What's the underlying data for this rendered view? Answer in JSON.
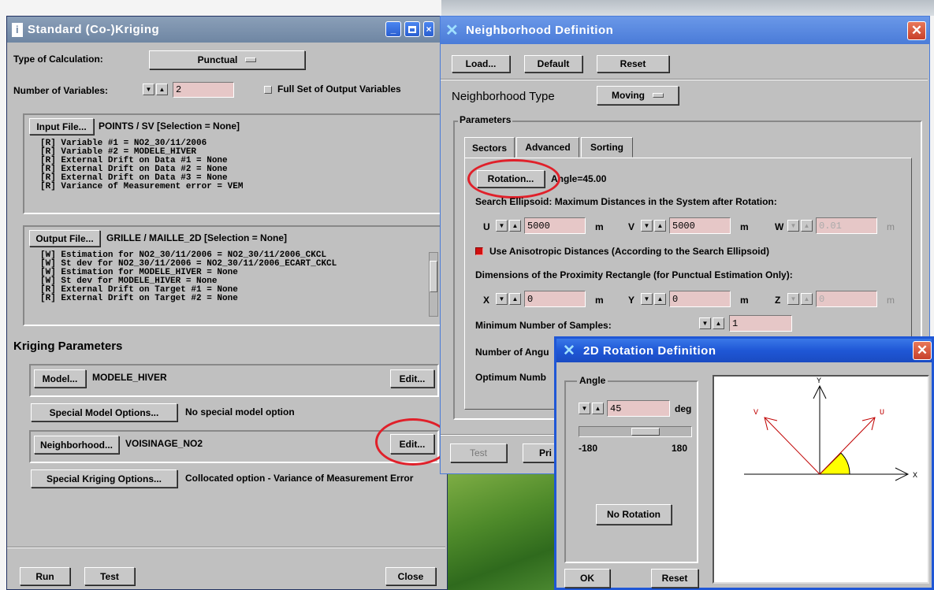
{
  "kriging": {
    "title": "Standard (Co-)Kriging",
    "calc_label": "Type of Calculation:",
    "calc_value": "Punctual",
    "numvars_label": "Number of Variables:",
    "numvars_value": "2",
    "fullset_label": "Full Set of Output Variables",
    "input_button": "Input File...",
    "input_file": "POINTS / SV [Selection = None]",
    "input_lines": [
      "[R] Variable #1 = NO2_30/11/2006",
      "[R] Variable #2 = MODELE_HIVER",
      "[R] External Drift on Data #1 = None",
      "[R] External Drift on Data #2 = None",
      "[R] External Drift on Data #3 = None",
      "[R] Variance of Measurement error = VEM"
    ],
    "output_button": "Output File...",
    "output_file": "GRILLE / MAILLE_2D [Selection = None]",
    "output_lines": [
      "[W] Estimation for NO2_30/11/2006 = NO2_30/11/2006_CKCL",
      "[W] St dev for NO2_30/11/2006 = NO2_30/11/2006_ECART_CKCL",
      "[W] Estimation for MODELE_HIVER = None",
      "[W] St dev for MODELE_HIVER = None",
      "[R] External Drift on Target #1 = None",
      "[R] External Drift on Target #2 = None"
    ],
    "params_heading": "Kriging Parameters",
    "model_button": "Model...",
    "model_value": "MODELE_HIVER",
    "edit_label": "Edit...",
    "special_model_button": "Special Model Options...",
    "special_model_value": "No special model option",
    "neigh_button": "Neighborhood...",
    "neigh_value": "VOISINAGE_NO2",
    "special_kriging_button": "Special Kriging Options...",
    "special_kriging_value": "Collocated option - Variance of Measurement Error",
    "run": "Run",
    "test": "Test",
    "close": "Close"
  },
  "neighborhood": {
    "title": "Neighborhood Definition",
    "load": "Load...",
    "default": "Default",
    "reset": "Reset",
    "type_label": "Neighborhood Type",
    "type_value": "Moving",
    "params_label": "Parameters",
    "tabs": [
      "Sectors",
      "Advanced",
      "Sorting"
    ],
    "rotation_button": "Rotation...",
    "angle_text": "Angle=45.00",
    "search_label": "Search Ellipsoid: Maximum Distances in the System after Rotation:",
    "u_label": "U",
    "u_value": "5000",
    "v_label": "V",
    "v_value": "5000",
    "w_label": "W",
    "w_value": "0.01",
    "unit_m": "m",
    "aniso_label": "Use Anisotropic Distances (According to the Search Ellipsoid)",
    "rect_label": "Dimensions of the Proximity Rectangle (for Punctual Estimation Only):",
    "x_label": "X",
    "x_value": "0",
    "y_label": "Y",
    "y_value": "0",
    "z_label": "Z",
    "z_value": "0",
    "min_samples_label": "Minimum Number of Samples:",
    "min_samples_value": "1",
    "num_angular_label": "Number of Angu",
    "optimum_label": "Optimum Numb",
    "test": "Test",
    "print": "Pri"
  },
  "rotation": {
    "title": "2D Rotation Definition",
    "angle_group": "Angle",
    "angle_value": "45",
    "deg": "deg",
    "min": "-180",
    "max": "180",
    "slider_fraction": 0.625,
    "no_rotation": "No Rotation",
    "ok": "OK",
    "reset": "Reset",
    "axis_y": "Y",
    "axis_x": "X",
    "axis_v": "V",
    "axis_u": "U"
  },
  "colors": {
    "field_bg": "#e6c7c7",
    "xp_title": "#1f57d6",
    "annotation_ring": "#e0202a"
  }
}
